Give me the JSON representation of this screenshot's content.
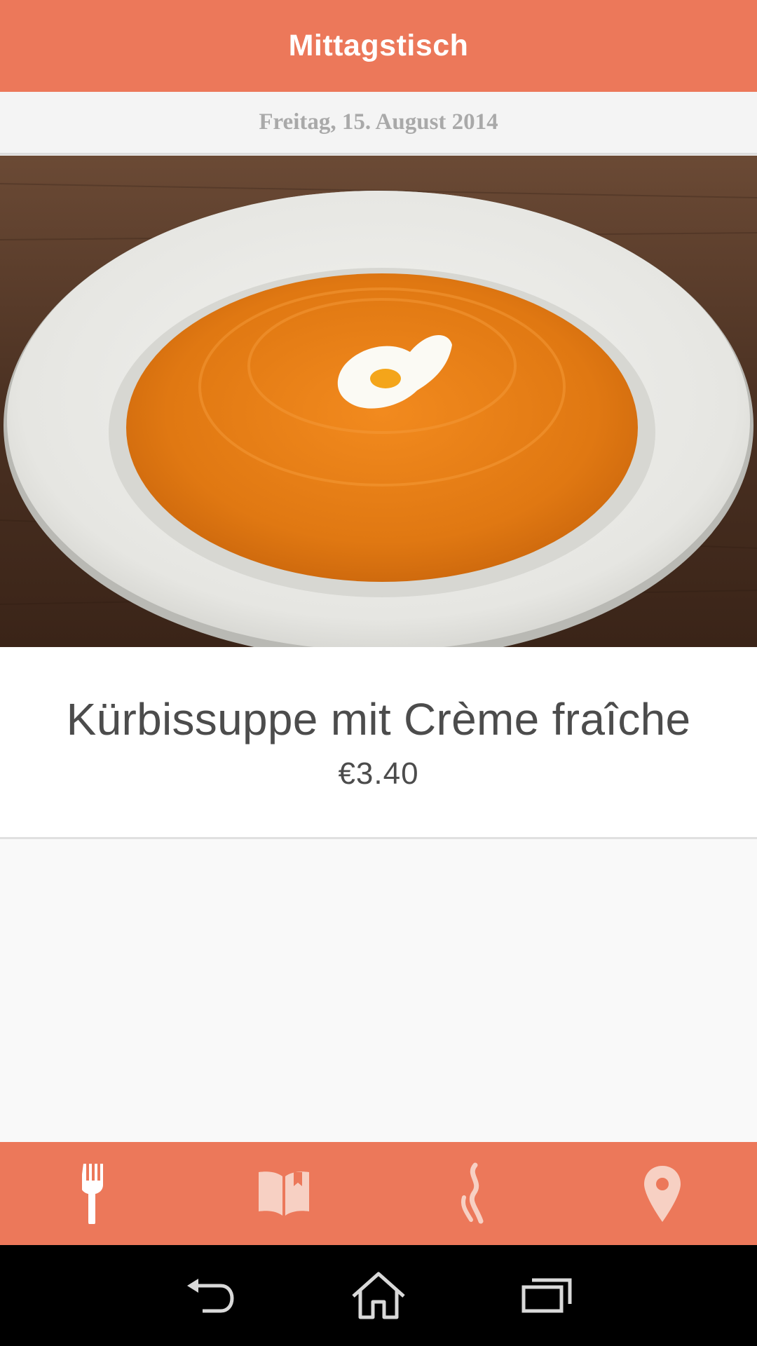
{
  "header": {
    "title": "Mittagstisch"
  },
  "date": {
    "label": "Freitag, 15. August 2014"
  },
  "dish": {
    "image_alt": "Kürbissuppe in weißem Teller",
    "name": "Kürbissuppe mit Crème fraîche",
    "price": "€3.40"
  },
  "tabs": [
    {
      "icon": "fork-icon",
      "active": true
    },
    {
      "icon": "book-icon",
      "active": false
    },
    {
      "icon": "steam-icon",
      "active": false
    },
    {
      "icon": "location-pin-icon",
      "active": false
    }
  ],
  "system_nav": [
    {
      "icon": "back-icon"
    },
    {
      "icon": "home-icon"
    },
    {
      "icon": "recent-apps-icon"
    }
  ],
  "colors": {
    "accent": "#ec785a",
    "tab_active": "#ffffff",
    "tab_inactive": "#f7d0c3"
  }
}
